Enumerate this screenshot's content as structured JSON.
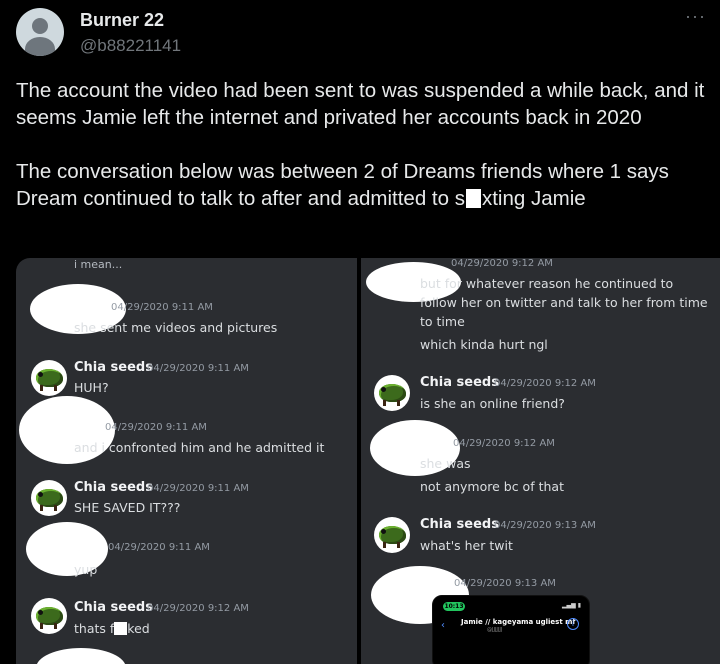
{
  "tweet": {
    "display_name": "Burner 22",
    "handle": "@b88221141",
    "more_label": "···",
    "paragraph1": "The account the video had been sent to was suspended a while back, and it seems Jamie left the internet and privated her accounts back in 2020",
    "paragraph2_before": "The conversation below was between 2 of Dreams friends where 1 says Dream continued to talk to after and admitted to s",
    "paragraph2_after": "xting Jamie"
  },
  "left_panel": {
    "top_partial": "i mean...",
    "messages": [
      {
        "timestamp": "04/29/2020 9:11 AM",
        "text": "she sent me videos and pictures"
      },
      {
        "username": "Chia seeds",
        "timestamp": "04/29/2020 9:11 AM",
        "text": "HUH?"
      },
      {
        "timestamp": "04/29/2020 9:11 AM",
        "text": "and i confronted him and he admitted it"
      },
      {
        "username": "Chia seeds",
        "timestamp": "04/29/2020 9:11 AM",
        "text": "SHE SAVED IT???"
      },
      {
        "timestamp": "04/29/2020 9:11 AM",
        "text": "yup"
      },
      {
        "username": "Chia seeds",
        "timestamp": "04/29/2020 9:12 AM",
        "text_before": "thats f",
        "text_after": "ked"
      }
    ]
  },
  "right_panel": {
    "top_partial": "04/29/2020 9:12 AM",
    "lines_top": [
      "but for whatever reason he continued to",
      "follow her on twitter and talk to her from time",
      "to time",
      "which kinda hurt ngl"
    ],
    "messages": [
      {
        "username": "Chia seeds",
        "timestamp": "04/29/2020 9:12 AM",
        "text": "is she an online friend?"
      },
      {
        "timestamp": "04/29/2020 9:12 AM",
        "text": "she was",
        "text2": "not anymore bc of that"
      },
      {
        "username": "Chia seeds",
        "timestamp": "04/29/2020 9:13 AM",
        "text": "what's her twit"
      },
      {
        "timestamp": "04/29/2020 9:13 AM"
      }
    ],
    "phone": {
      "time": "10:13",
      "back": "‹",
      "title": "Jamie // kageyama ugliest mf",
      "subtitle": "@JJJJJJJ",
      "info": "i"
    }
  }
}
